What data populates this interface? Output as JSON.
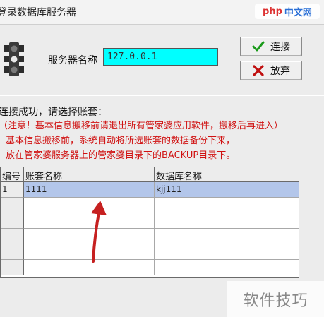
{
  "window": {
    "title": "登录数据库服务器"
  },
  "watermark": {
    "logo_latin": "php",
    "logo_cn": "中文网",
    "bottom_text": "软件技巧"
  },
  "server": {
    "label": "服务器名称",
    "value": "127.0.0.1"
  },
  "buttons": {
    "connect": "连接",
    "cancel": "放弃"
  },
  "messages": {
    "line1": "连接成功，请选择账套：",
    "line2": "（注意！基本信息搬移前请退出所有管家婆应用软件，搬移后再进入）",
    "line3": "基本信息搬移前，系统自动将所选账套的数据备份下来，",
    "line4": "放在管家婆服务器上的管家婆目录下的BACKUP目录下。"
  },
  "table": {
    "columns": [
      "编号",
      "账套名称",
      "数据库名称"
    ],
    "rows": [
      [
        "1",
        "1111",
        "kjj111"
      ]
    ],
    "selected_row": 0
  },
  "colors": {
    "server_input_bg": "#00ffff",
    "warning_text": "#d01010",
    "selected_row": "#b3c6ea",
    "connect_icon": "#1a9a1a",
    "cancel_icon": "#c01010",
    "annotation_arrow": "#c62020"
  },
  "icons": {
    "app": "traffic-light-icon",
    "connect": "checkmark-icon",
    "cancel": "x-mark-icon"
  }
}
